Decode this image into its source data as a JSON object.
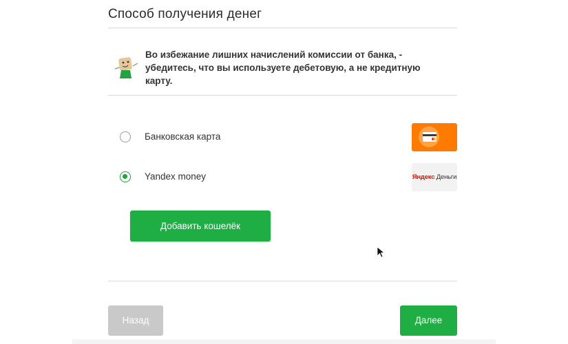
{
  "page": {
    "title": "Способ получения денег"
  },
  "notice": {
    "line1": "Во избежание лишних начислений комиссии от банка, -",
    "line2": "убедитесь, что вы используете дебетовую, а не кредитную",
    "line3": "карту.",
    "mascot_icon": "mascot-icon"
  },
  "payment_options": [
    {
      "label": "Банковская карта",
      "selected": false,
      "logo": "bank-card-icon"
    },
    {
      "label": "Yandex money",
      "selected": true,
      "logo": "yandex-money-logo",
      "logo_text_red": "Яндекс",
      "logo_text_rest": "Деньги"
    }
  ],
  "buttons": {
    "add_wallet": "Добавить кошелёк",
    "back": "Назад",
    "next": "Далее"
  },
  "colors": {
    "accent": "#1fae44",
    "disabled": "#c9c9c9",
    "card_logo_bg": "#ff7a00"
  }
}
